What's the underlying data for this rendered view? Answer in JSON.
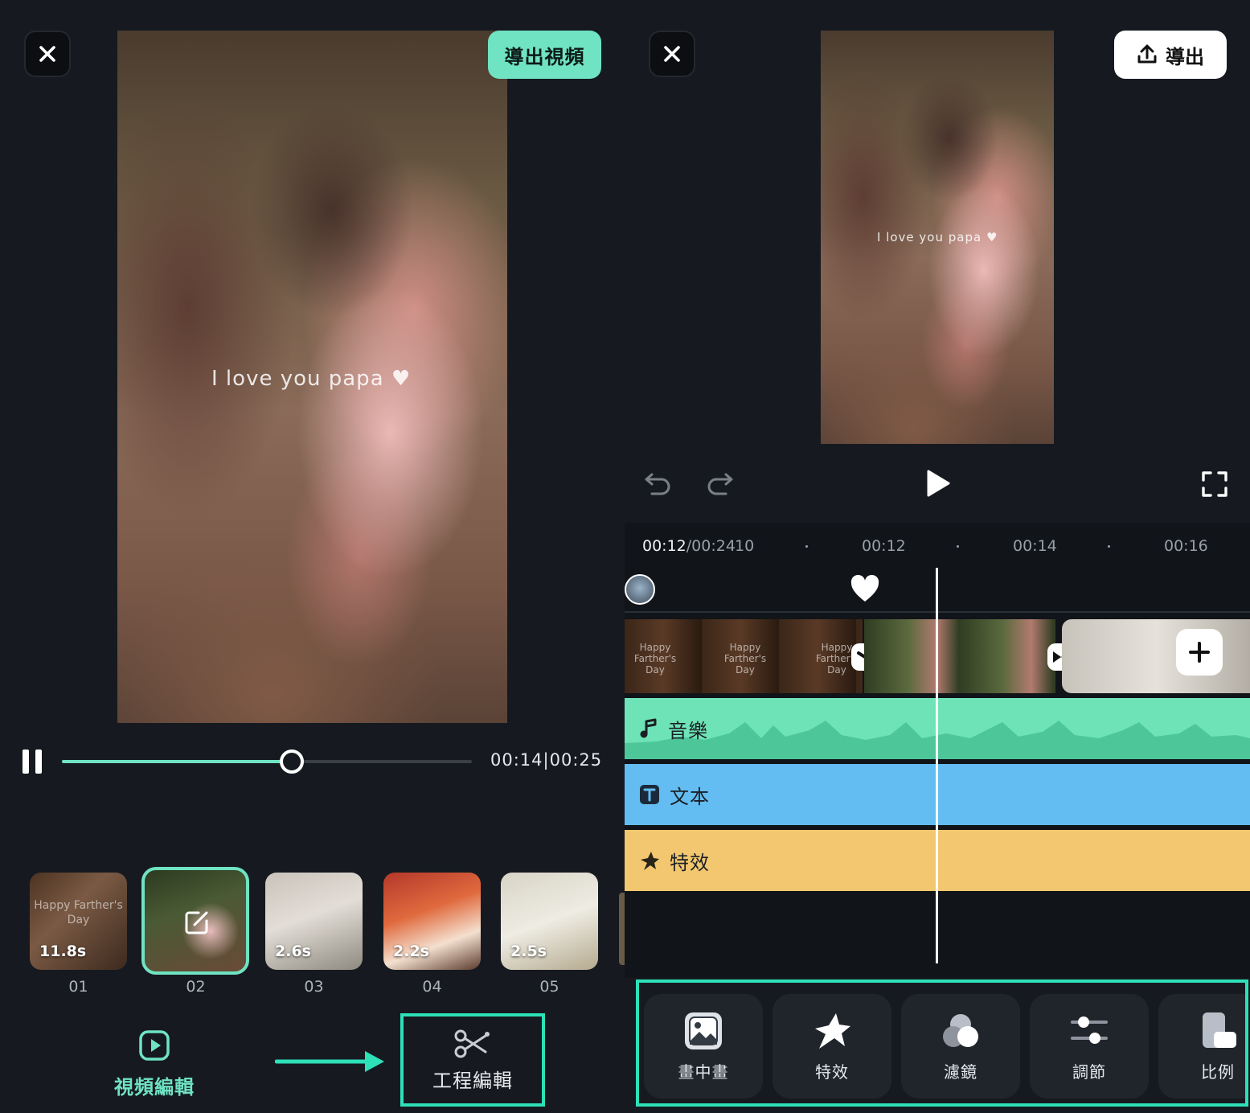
{
  "left": {
    "export_video_label": "導出視頻",
    "overlay_caption": "I love you papa",
    "playback": {
      "time": "00:14|00:25",
      "progress": 0.56
    },
    "thumbnails": [
      {
        "duration": "11.8s",
        "number": "01",
        "text": "Happy Farther's Day"
      },
      {
        "duration": "",
        "number": "02",
        "text": ""
      },
      {
        "duration": "2.6s",
        "number": "03",
        "text": ""
      },
      {
        "duration": "2.2s",
        "number": "04",
        "text": ""
      },
      {
        "duration": "2.5s",
        "number": "05",
        "text": ""
      }
    ],
    "tabs": {
      "video_edit": "視頻編輯",
      "project_edit": "工程編輯"
    }
  },
  "right": {
    "export_label": "導出",
    "overlay_caption": "I love you papa",
    "timeline": {
      "current": "00:12",
      "total": "/00:24",
      "ticks": [
        "10",
        "00:12",
        "00:14",
        "00:16"
      ],
      "clip_text": "Happy Farther's Day"
    },
    "tracks": {
      "music": "音樂",
      "text": "文本",
      "effect": "特效"
    },
    "tools": [
      {
        "label": "畫中畫",
        "icon": "picture-in-picture-icon"
      },
      {
        "label": "特效",
        "icon": "effects-star-icon"
      },
      {
        "label": "濾鏡",
        "icon": "filter-icon"
      },
      {
        "label": "調節",
        "icon": "adjust-sliders-icon"
      },
      {
        "label": "比例",
        "icon": "aspect-ratio-icon"
      }
    ]
  },
  "colors": {
    "accent": "#6fe3c2",
    "highlight_border": "#2ee0b8",
    "music_track": "#6fe3b8",
    "text_track": "#63bdf2",
    "effect_track": "#f2c76f",
    "background": "#161a20"
  }
}
